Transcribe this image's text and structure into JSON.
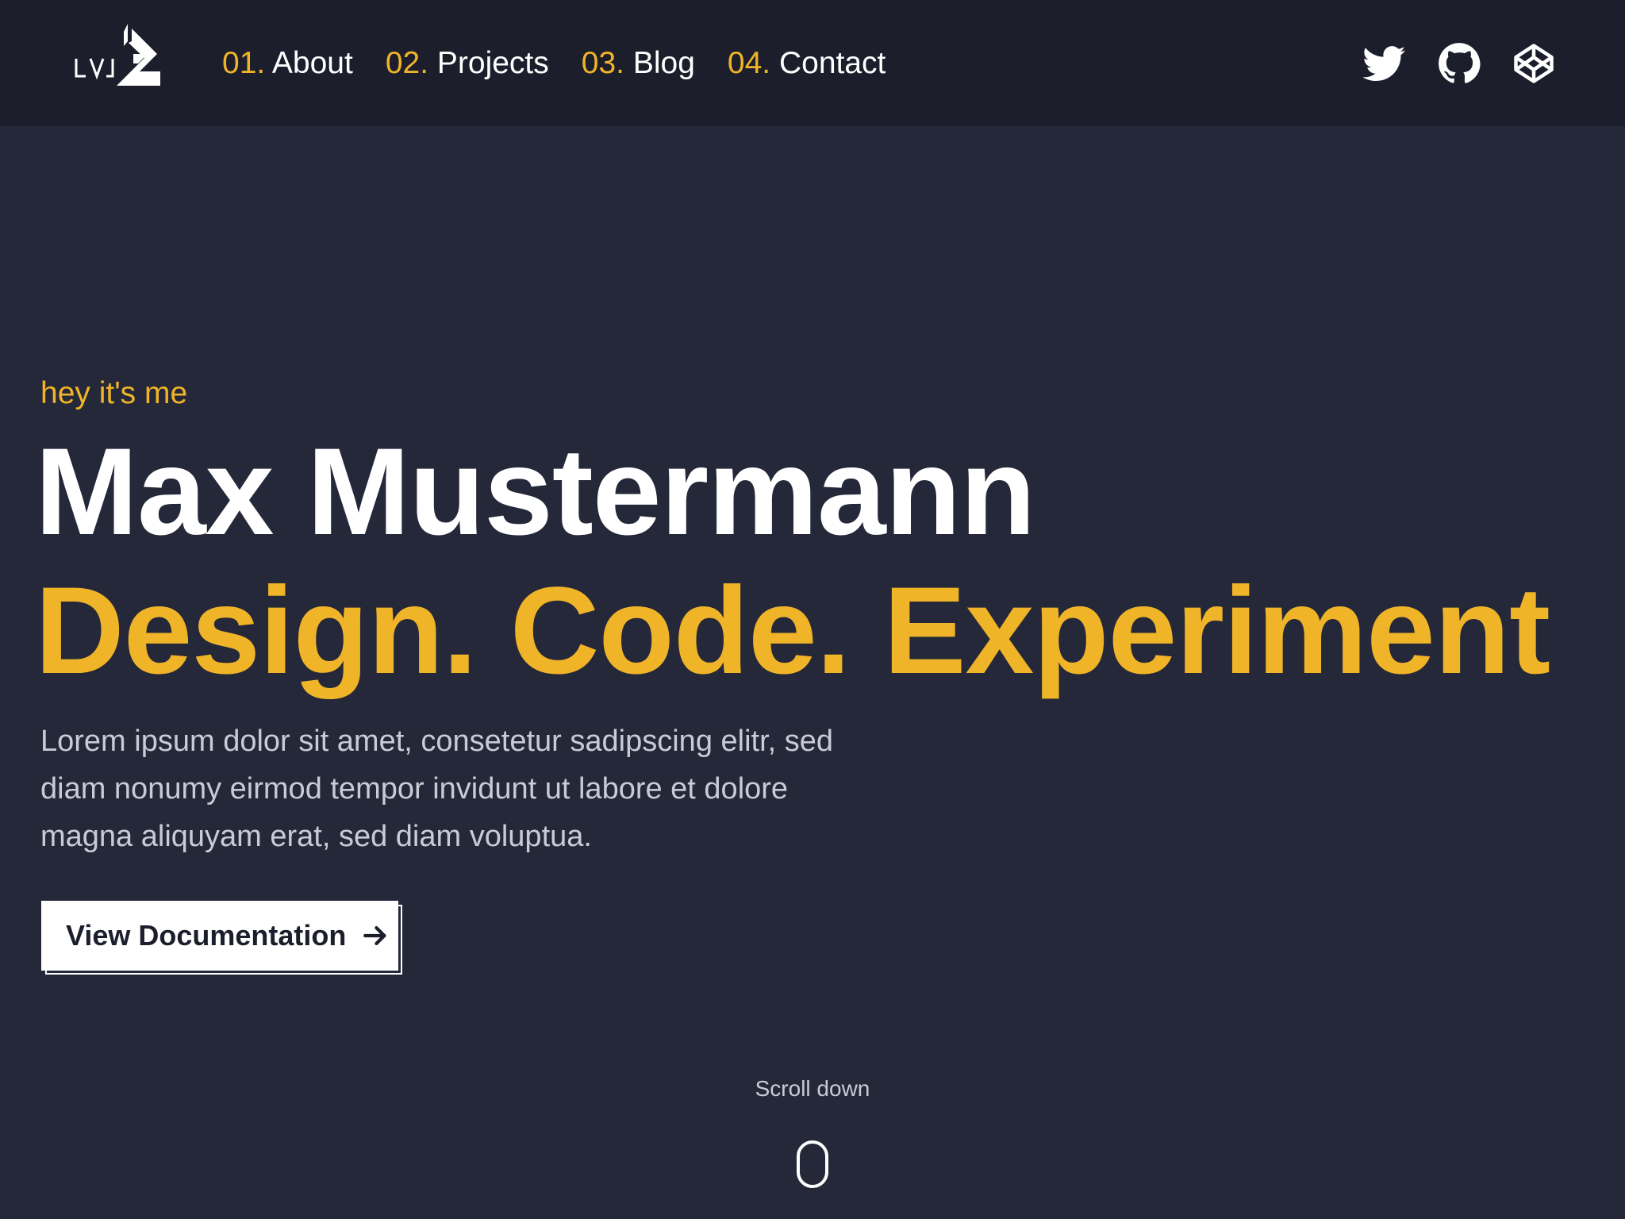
{
  "header": {
    "logo_alt": "LV logo",
    "nav": [
      {
        "num": "01.",
        "label": "About"
      },
      {
        "num": "02.",
        "label": "Projects"
      },
      {
        "num": "03.",
        "label": "Blog"
      },
      {
        "num": "04.",
        "label": "Contact"
      }
    ],
    "social_icons": [
      "twitter-icon",
      "github-icon",
      "codepen-icon"
    ]
  },
  "hero": {
    "greeting": "hey it's me",
    "name": "Max Mustermann",
    "tagline": "Design. Code. Experiment",
    "description": "Lorem ipsum dolor sit amet, consetetur sadipscing elitr, sed diam nonumy eirmod tempor invidunt ut labore et dolore magna aliquyam erat, sed diam voluptua.",
    "button_label": "View Documentation",
    "button_icon": "arrow-right-icon"
  },
  "scroll": {
    "label": "Scroll down",
    "icon": "mouse-icon"
  },
  "colors": {
    "accent": "#f0b429",
    "background": "#252839",
    "header_background": "#1c1e2b",
    "text": "#ffffff",
    "muted_text": "#c9cbd6"
  }
}
